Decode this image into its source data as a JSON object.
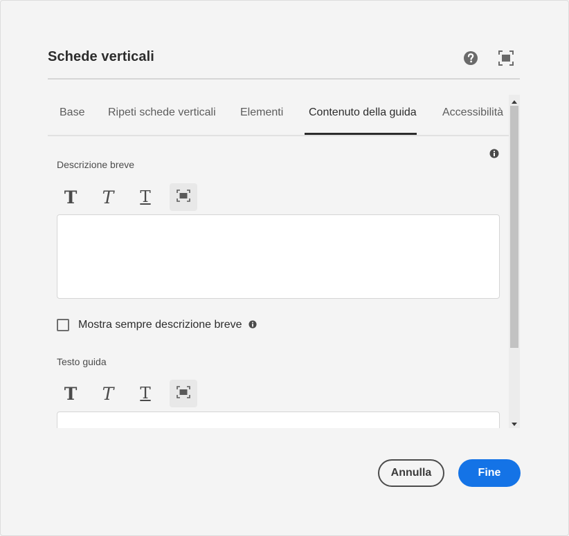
{
  "dialog": {
    "title": "Schede verticali",
    "help_icon": "help-icon",
    "fullscreen_icon": "fullscreen-icon"
  },
  "tabs": [
    {
      "label": "Base",
      "active": false
    },
    {
      "label": "Ripeti schede verticali",
      "active": false
    },
    {
      "label": "Elementi",
      "active": false
    },
    {
      "label": "Contenuto della guida",
      "active": true
    },
    {
      "label": "Accessibilità",
      "active": false
    }
  ],
  "short_description": {
    "label": "Descrizione breve",
    "value": "",
    "info_icon": "info-icon",
    "toolbar": {
      "bold": "T",
      "italic": "T",
      "underline": "T",
      "expand_icon": "expand-icon"
    }
  },
  "always_show": {
    "label": "Mostra sempre descrizione breve",
    "checked": false
  },
  "help_text": {
    "label": "Testo guida",
    "value": "",
    "toolbar": {
      "bold": "T",
      "italic": "T",
      "underline": "T",
      "expand_icon": "expand-icon"
    }
  },
  "footer": {
    "cancel_label": "Annulla",
    "done_label": "Fine"
  },
  "colors": {
    "accent": "#1473e6",
    "background": "#f4f4f4",
    "text": "#2c2c2c"
  }
}
